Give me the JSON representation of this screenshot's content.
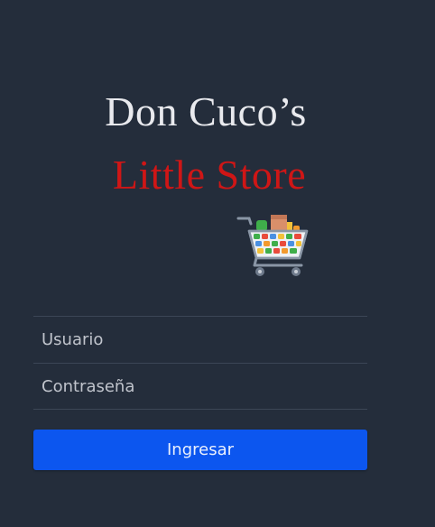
{
  "brand": {
    "line1": "Don Cuco’s",
    "line2": "Little Store"
  },
  "logo": {
    "icon": "shopping-cart-icon"
  },
  "form": {
    "username_placeholder": "Usuario",
    "username_value": "",
    "password_placeholder": "Contraseña",
    "password_value": "",
    "submit_label": "Ingresar"
  },
  "colors": {
    "background": "#242d3b",
    "brand_primary": "#e9eaee",
    "brand_accent": "#cf1616",
    "button": "#0c56ef"
  }
}
